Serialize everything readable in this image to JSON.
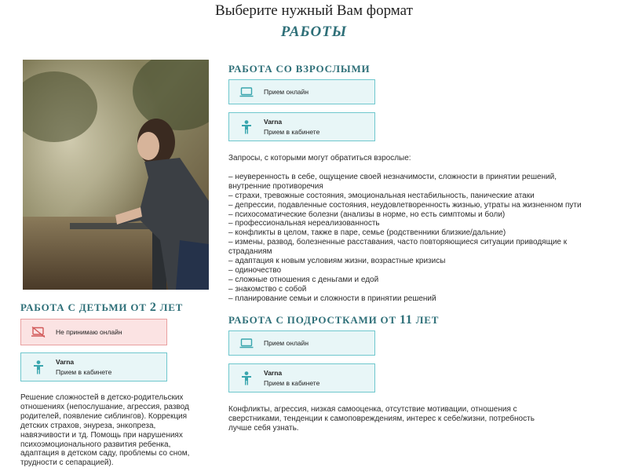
{
  "header": {
    "title": "Выберите нужный Вам формат",
    "subtitle": "РАБОТЫ"
  },
  "colors": {
    "accent": "#2e6f78",
    "card_border": "#6fc7cd",
    "card_bg": "#e8f6f7",
    "card_off_border": "#e9a0a0",
    "card_off_bg": "#fbe3e3"
  },
  "adults": {
    "heading": "РАБОТА СО ВЗРОСЛЫМИ",
    "online_card": {
      "label": "Прием онлайн",
      "icon": "laptop-icon"
    },
    "office_card": {
      "city": "Varna",
      "label": "Прием в кабинете",
      "icon": "person-icon"
    },
    "intro": "Запросы, с которыми могут обратиться взрослые:",
    "items": [
      "– неуверенность в себе, ощущение своей незначимости, сложности в принятии решений, внутренние противоречия",
      "– страхи, тревожные состояния, эмоциональная нестабильность, панические атаки",
      "– депрессии, подавленные состояния, неудовлетворенность жизнью, утраты на жизненном пути",
      "– психосоматические болезни (анализы в норме, но есть симптомы и боли)",
      "– профессиональная нереализованность",
      "– конфликты в целом, также в паре, семье (родственники близкие/дальние)",
      "– измены, развод, болезненные расставания, часто повторяющиеся ситуации приводящие к страданиям",
      "– адаптация к новым условиям жизни, возрастные кризисы",
      "– одиночество",
      "– сложные отношения с деньгами и едой",
      "– знакомство с собой",
      "– планирование семьи и сложности в принятии решений"
    ]
  },
  "children": {
    "heading": "РАБОТА С ДЕТЬМИ ОТ",
    "heading_num": "2",
    "heading_suffix": "ЛЕТ",
    "online_card": {
      "label": "Не принимаю онлайн",
      "icon": "laptop-off-icon"
    },
    "office_card": {
      "city": "Varna",
      "label": "Прием в кабинете",
      "icon": "person-icon"
    },
    "text": "Решение сложностей в детско-родительских отношениях (непослушание, агрессия, развод родителей, появление сиблингов). Коррекция детских страхов, энуреза, энкопреза, навязчивости и тд. Помощь при нарушениях психоэмоционального развития ребенка, адаптация в детском саду, проблемы со сном, трудности с сепарацией)."
  },
  "teens": {
    "heading": "РАБОТА С ПОДРОСТКАМИ ОТ",
    "heading_num": "11",
    "heading_suffix": "ЛЕТ",
    "online_card": {
      "label": "Прием онлайн",
      "icon": "laptop-icon"
    },
    "office_card": {
      "city": "Varna",
      "label": "Прием в кабинете",
      "icon": "person-icon"
    },
    "text": "Конфликты, агрессия, низкая самооценка, отсутствие мотивации, отношения с сверстниками, тенденции к самоповреждениям, интерес к себе/жизни, потребность лучше себя узнать."
  }
}
